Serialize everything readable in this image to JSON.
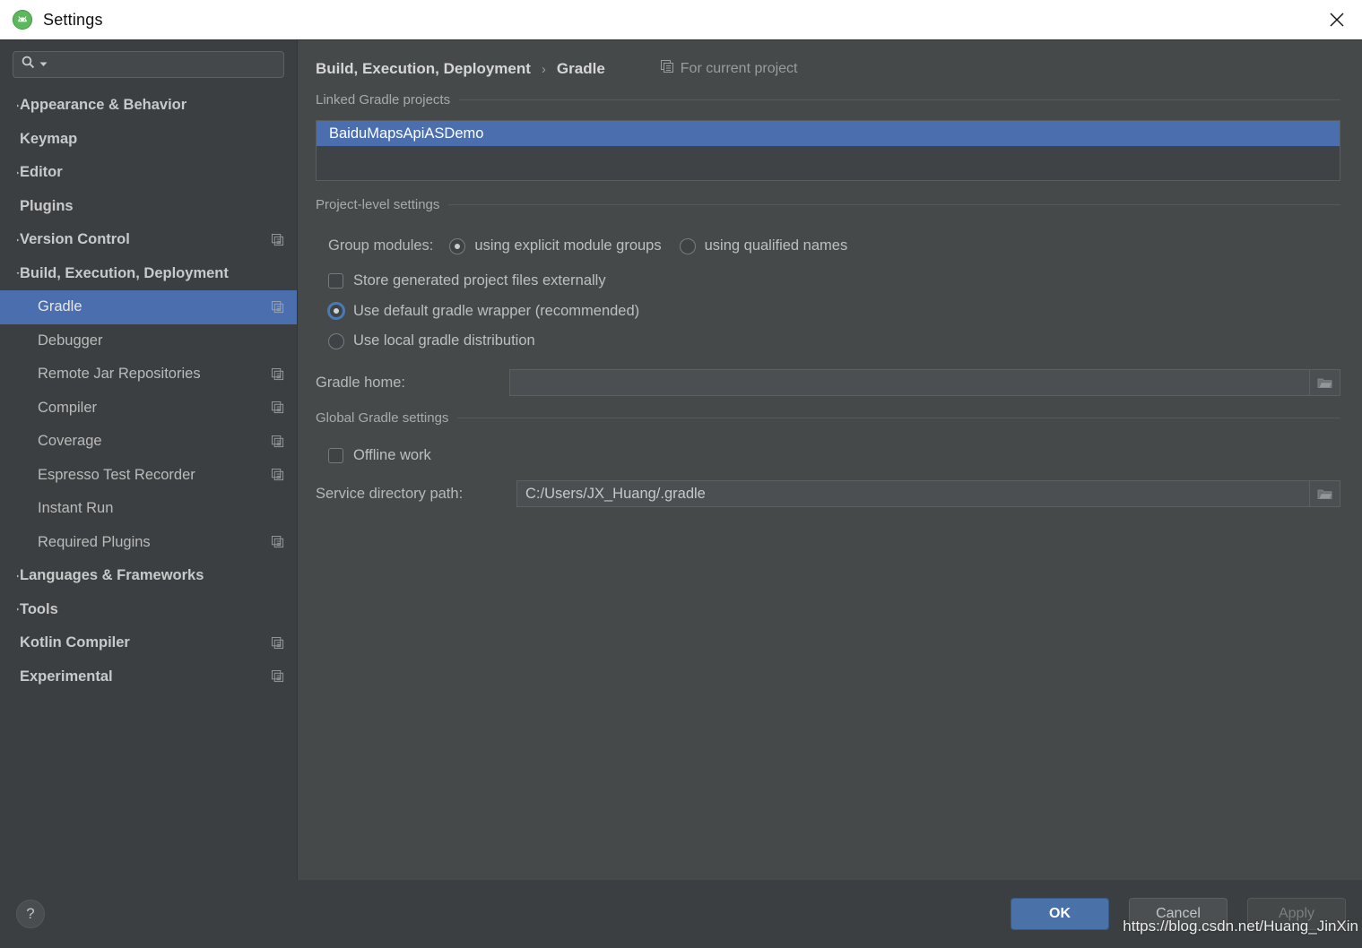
{
  "window": {
    "title": "Settings",
    "app_icon": "android-studio-icon",
    "close_icon": "close-icon"
  },
  "sidebar": {
    "search": {
      "placeholder": "",
      "value": "",
      "icon": "search-icon",
      "dropdown_icon": "chevron-down-icon"
    },
    "items": [
      {
        "label": "Appearance & Behavior",
        "level": 0,
        "arrow": "collapsed",
        "copy": false,
        "selected": false
      },
      {
        "label": "Keymap",
        "level": 0,
        "arrow": "none",
        "copy": false,
        "selected": false
      },
      {
        "label": "Editor",
        "level": 0,
        "arrow": "collapsed",
        "copy": false,
        "selected": false
      },
      {
        "label": "Plugins",
        "level": 0,
        "arrow": "none",
        "copy": false,
        "selected": false
      },
      {
        "label": "Version Control",
        "level": 0,
        "arrow": "collapsed",
        "copy": true,
        "selected": false
      },
      {
        "label": "Build, Execution, Deployment",
        "level": 0,
        "arrow": "expanded",
        "copy": false,
        "selected": false
      },
      {
        "label": "Gradle",
        "level": 1,
        "arrow": "collapsed",
        "copy": true,
        "selected": true
      },
      {
        "label": "Debugger",
        "level": 1,
        "arrow": "collapsed",
        "copy": false,
        "selected": false
      },
      {
        "label": "Remote Jar Repositories",
        "level": 1,
        "arrow": "none",
        "copy": true,
        "selected": false
      },
      {
        "label": "Compiler",
        "level": 1,
        "arrow": "none",
        "copy": true,
        "selected": false
      },
      {
        "label": "Coverage",
        "level": 1,
        "arrow": "none",
        "copy": true,
        "selected": false
      },
      {
        "label": "Espresso Test Recorder",
        "level": 1,
        "arrow": "none",
        "copy": true,
        "selected": false
      },
      {
        "label": "Instant Run",
        "level": 1,
        "arrow": "none",
        "copy": false,
        "selected": false
      },
      {
        "label": "Required Plugins",
        "level": 1,
        "arrow": "none",
        "copy": true,
        "selected": false
      },
      {
        "label": "Languages & Frameworks",
        "level": 0,
        "arrow": "collapsed",
        "copy": false,
        "selected": false
      },
      {
        "label": "Tools",
        "level": 0,
        "arrow": "collapsed",
        "copy": false,
        "selected": false
      },
      {
        "label": "Kotlin Compiler",
        "level": 0,
        "arrow": "none",
        "copy": true,
        "selected": false
      },
      {
        "label": "Experimental",
        "level": 0,
        "arrow": "none",
        "copy": true,
        "selected": false
      }
    ]
  },
  "content": {
    "breadcrumb": {
      "parent": "Build, Execution, Deployment",
      "separator": "›",
      "current": "Gradle"
    },
    "for_current_project": {
      "label": "For current project",
      "icon": "copy-icon"
    },
    "linked_projects": {
      "group_title": "Linked Gradle projects",
      "items": [
        {
          "name": "BaiduMapsApiASDemo",
          "selected": true
        }
      ]
    },
    "project_level": {
      "group_title": "Project-level settings",
      "group_modules_label": "Group modules:",
      "group_modules_options": [
        {
          "label": "using explicit module groups",
          "selected": true
        },
        {
          "label": "using qualified names",
          "selected": false
        }
      ],
      "store_externally": {
        "label": "Store generated project files externally",
        "checked": false
      },
      "use_wrapper": {
        "label": "Use default gradle wrapper (recommended)",
        "selected": true
      },
      "use_local": {
        "label": "Use local gradle distribution",
        "selected": false
      },
      "gradle_home": {
        "label": "Gradle home:",
        "value": "",
        "placeholder": "",
        "browse_icon": "folder-icon"
      }
    },
    "global_settings": {
      "group_title": "Global Gradle settings",
      "offline_work": {
        "label": "Offline work",
        "checked": false
      },
      "service_dir": {
        "label": "Service directory path:",
        "value": "C:/Users/JX_Huang/.gradle",
        "browse_icon": "folder-icon"
      }
    }
  },
  "footer": {
    "help": {
      "label": "?",
      "icon": "help-icon"
    },
    "ok": "OK",
    "cancel": "Cancel",
    "apply": "Apply",
    "watermark": "https://blog.csdn.net/Huang_JinXin"
  },
  "colors": {
    "accent_selection": "#4b6eaf",
    "primary_button": "#4a72a8",
    "sidebar_bg": "#3c3f41",
    "content_bg": "#45494a",
    "titlebar_bg": "#ffffff"
  }
}
